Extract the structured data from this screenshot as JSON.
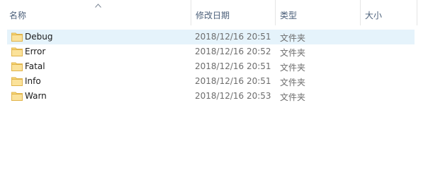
{
  "columns": {
    "name": "名称",
    "date": "修改日期",
    "type": "类型",
    "size": "大小"
  },
  "sort": {
    "column": "name",
    "direction": "ascending",
    "icon": "caret-up-icon"
  },
  "selection": {
    "colors": {
      "selected_row_bg": "#e5f3fb",
      "folder": "#f8d775"
    }
  },
  "rows": [
    {
      "name": "Debug",
      "date": "2018/12/16 20:51",
      "type": "文件夹",
      "size": "",
      "selected": true,
      "icon": "folder-icon"
    },
    {
      "name": "Error",
      "date": "2018/12/16 20:52",
      "type": "文件夹",
      "size": "",
      "selected": false,
      "icon": "folder-icon"
    },
    {
      "name": "Fatal",
      "date": "2018/12/16 20:51",
      "type": "文件夹",
      "size": "",
      "selected": false,
      "icon": "folder-icon"
    },
    {
      "name": "Info",
      "date": "2018/12/16 20:51",
      "type": "文件夹",
      "size": "",
      "selected": false,
      "icon": "folder-icon"
    },
    {
      "name": "Warn",
      "date": "2018/12/16 20:53",
      "type": "文件夹",
      "size": "",
      "selected": false,
      "icon": "folder-icon"
    }
  ]
}
